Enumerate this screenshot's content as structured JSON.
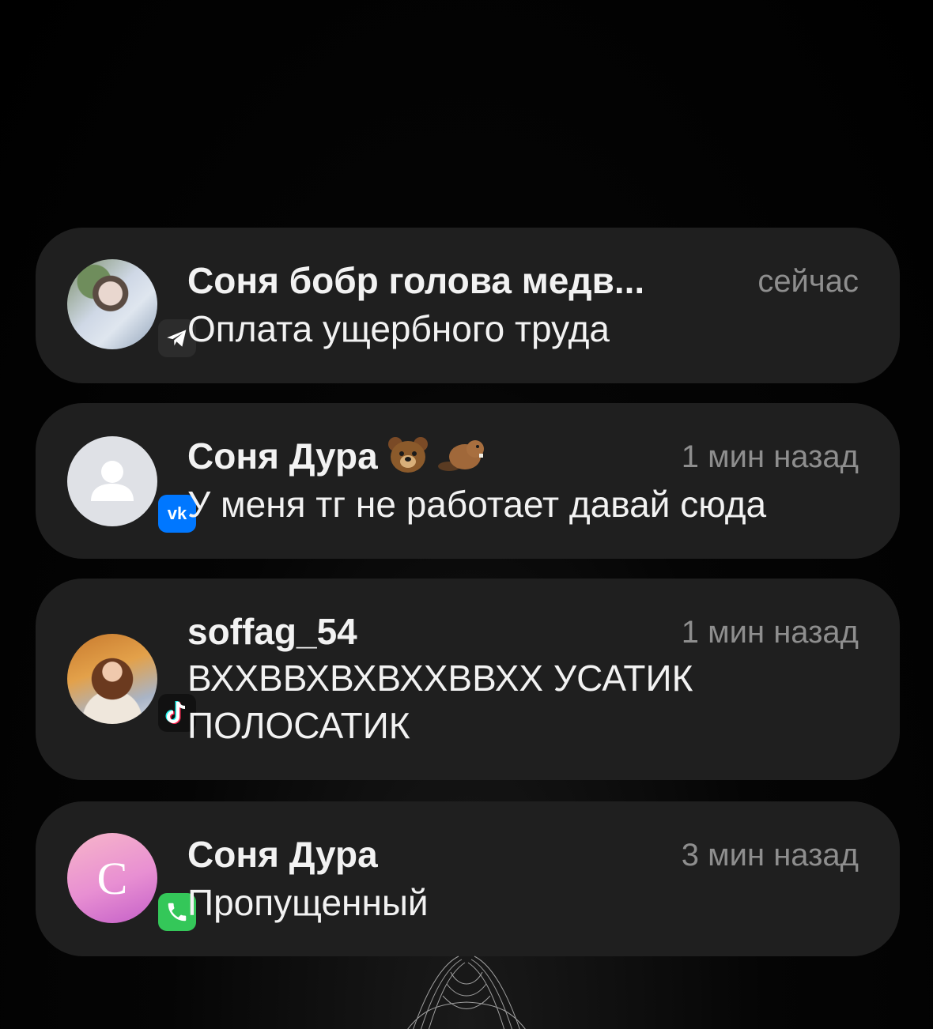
{
  "notifications": [
    {
      "title": "Соня бобр голова медв...",
      "time": "сейчас",
      "message": "Оплата ущербного труда",
      "app_icon": "telegram-icon",
      "avatar": "photo-avatar"
    },
    {
      "title": "Соня Дура",
      "time": "1 мин назад",
      "message": "У меня тг не работает давай сюда",
      "app_icon": "vk-icon",
      "avatar": "default-person-avatar",
      "emojis": [
        "bear-emoji",
        "beaver-emoji"
      ]
    },
    {
      "title": "soffag_54",
      "time": "1 мин назад",
      "message_line1": "ВХХВВХВХВХХВВХХ УСАТИК",
      "message_line2": "ПОЛОСАТИК",
      "app_icon": "tiktok-icon",
      "avatar": "photo-avatar"
    },
    {
      "title": "Соня Дура",
      "time": "3 мин назад",
      "message": "Пропущенный",
      "app_icon": "phone-icon",
      "avatar_letter": "С"
    }
  ],
  "colors": {
    "card": "#1f1f1f",
    "vk_blue": "#0077ff",
    "phone_green": "#34c759",
    "telegram_bg": "#2c2c2c",
    "tiktok_bg": "#111111"
  }
}
